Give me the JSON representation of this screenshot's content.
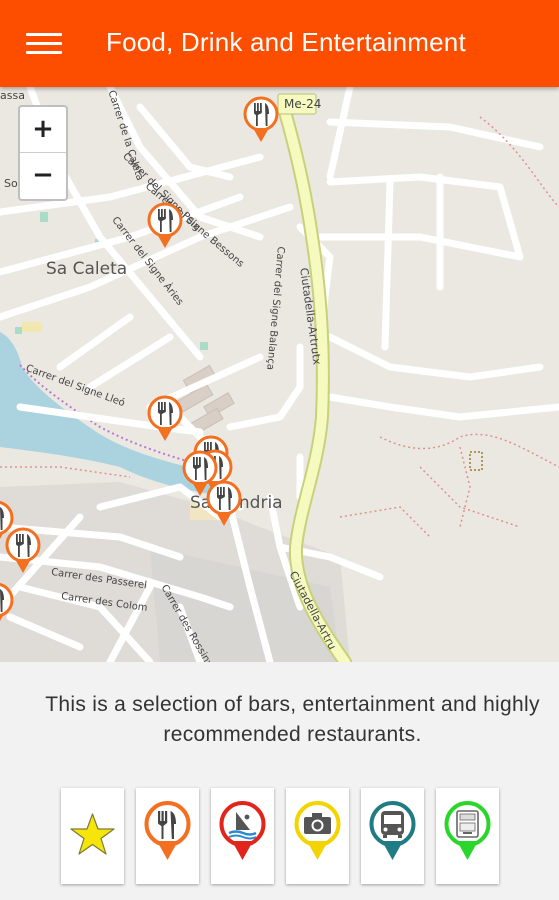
{
  "header": {
    "title": "Food, Drink and Entertainment",
    "menu_icon": "hamburger-menu-icon"
  },
  "map": {
    "zoom_in_label": "+",
    "zoom_out_label": "−",
    "labels": {
      "sa_caleta": "Sa Caleta",
      "sa_candria": "Sa Candria",
      "ciutadella_artrutx_1": "Ciutadella-Artrutx",
      "ciutadella_artrutx_2": "Ciutadella-Artru",
      "carrer_caleta": "Carrer de la Caleta",
      "carrer_peix": "Carrer del Signe Peix",
      "carrer_bessons": "Carrer del Signe Bessons",
      "carrer_aries": "Carrer del Signe Àries",
      "carrer_lleo": "Carrer del Signe Lleó",
      "carrer_balanca": "Carrer del Signe Balança",
      "carrer_passarel": "Carrer des Passerel",
      "carrer_colom": "Carrer des Colom",
      "carrer_rossinyol": "Carrer des Rossinyol",
      "road_ref": "Me-24",
      "partial_massa": "assa",
      "partial_sol": "Sol"
    },
    "marker_icon": "restaurant-fork-knife-icon",
    "marker_color": "#f37021"
  },
  "info": {
    "text": "This is a selection of bars, entertainment and highly recommended restaurants."
  },
  "categories": [
    {
      "name": "favorites",
      "icon": "star-icon",
      "color": "#f5e50a"
    },
    {
      "name": "restaurants",
      "icon": "restaurant-fork-knife-icon",
      "color": "#f37021"
    },
    {
      "name": "beaches-water-sports",
      "icon": "windsurf-icon",
      "color": "#e1251b"
    },
    {
      "name": "sightseeing",
      "icon": "camera-icon",
      "color": "#f4d400"
    },
    {
      "name": "transport",
      "icon": "bus-icon",
      "color": "#1f7b84"
    },
    {
      "name": "atm",
      "icon": "atm-icon",
      "color": "#2bd62b"
    }
  ]
}
